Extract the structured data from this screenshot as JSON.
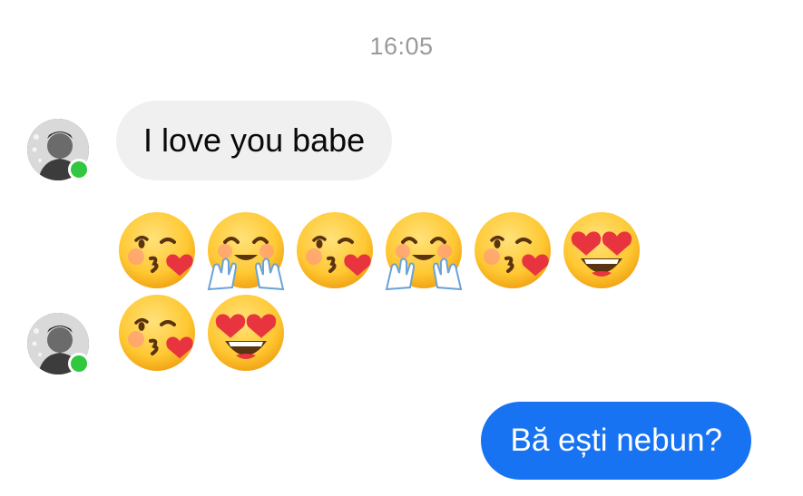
{
  "timestamp": "16:05",
  "messages": {
    "incoming_text": "I love you babe",
    "emoji_row_1": [
      "kissing-face-with-heart",
      "hugging-face",
      "kissing-face-with-heart",
      "hugging-face",
      "kissing-face-with-heart",
      "heart-eyes-face"
    ],
    "emoji_row_2": [
      "kissing-face-with-heart",
      "heart-eyes-face"
    ],
    "outgoing_text": "Bă ești nebun?"
  },
  "colors": {
    "incoming_bubble": "#f0f0f0",
    "outgoing_bubble": "#1873f2",
    "presence_dot": "#31c83f",
    "timestamp_text": "#9a9a9a"
  }
}
